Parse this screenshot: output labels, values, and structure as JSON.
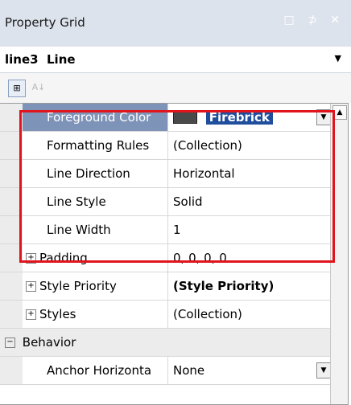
{
  "panel": {
    "title": "Property Grid",
    "title_icons": "□ ⊅ ✕"
  },
  "object_selector": {
    "name": "line3",
    "type": "Line"
  },
  "toolbar": {
    "categorized_icon": "categorized-view-icon",
    "alphabetical_icon": "alphabetical-sort-icon"
  },
  "rows": [
    {
      "name": "Foreground Color",
      "value": "Firebrick",
      "selected": true
    },
    {
      "name": "Formatting Rules",
      "value": "(Collection)"
    },
    {
      "name": "Line Direction",
      "value": "Horizontal"
    },
    {
      "name": "Line Style",
      "value": "Solid"
    },
    {
      "name": "Line Width",
      "value": "1"
    },
    {
      "name": "Padding",
      "value": "0, 0, 0, 0",
      "expandable": true
    },
    {
      "name": "Style Priority",
      "value": "(Style Priority)",
      "expandable": true
    },
    {
      "name": "Styles",
      "value": "(Collection)",
      "expandable": true
    }
  ],
  "category": {
    "label": "Behavior",
    "expander": "−"
  },
  "after_category": [
    {
      "name": "Anchor Horizonta",
      "value": "None"
    }
  ],
  "colors": {
    "selected_row": "#7e93b8",
    "highlight_box": "#e0141d",
    "swatch": "#4a4a4a"
  }
}
